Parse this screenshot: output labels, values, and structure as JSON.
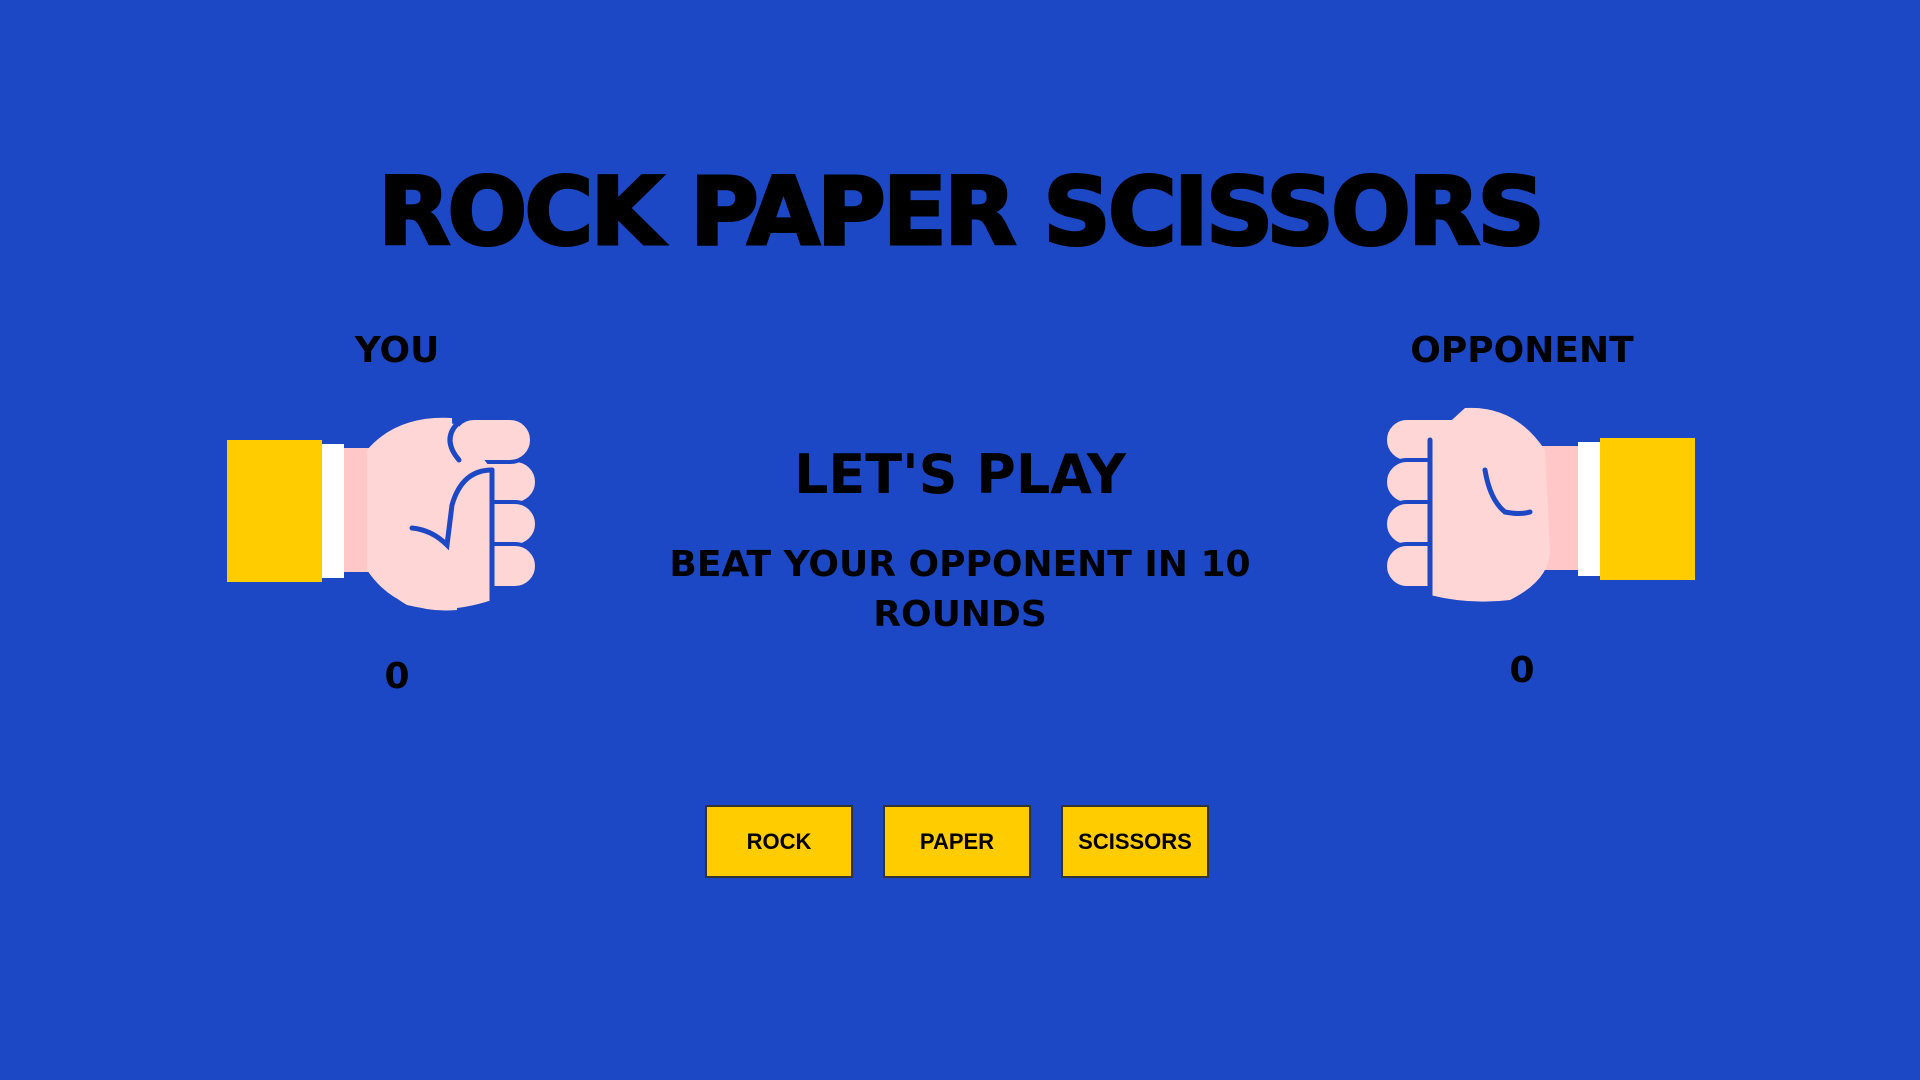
{
  "title": "ROCK PAPER SCISSORS",
  "players": {
    "you": {
      "label": "YOU",
      "score": "0",
      "hand_icon": "fist-icon"
    },
    "opponent": {
      "label": "OPPONENT",
      "score": "0",
      "hand_icon": "fist-icon"
    }
  },
  "status": {
    "heading": "LET'S PLAY",
    "message": "BEAT YOUR OPPONENT IN 10 ROUNDS"
  },
  "buttons": {
    "rock": "ROCK",
    "paper": "PAPER",
    "scissors": "SCISSORS"
  },
  "colors": {
    "background": "#1c48c5",
    "sleeve": "#ffcc00",
    "skin": "#ffd6d6",
    "button": "#ffcc00"
  }
}
